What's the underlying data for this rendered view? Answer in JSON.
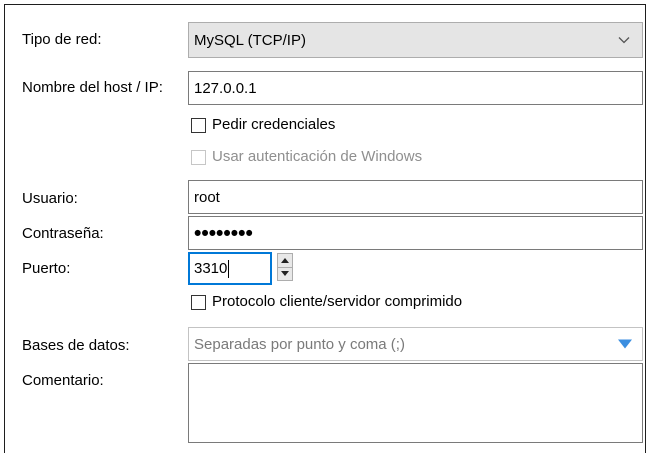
{
  "form": {
    "network_type": {
      "label": "Tipo de red:",
      "value": "MySQL (TCP/IP)"
    },
    "host": {
      "label": "Nombre del host / IP:",
      "value": "127.0.0.1"
    },
    "ask_credentials": {
      "label": "Pedir credenciales",
      "checked": false
    },
    "windows_auth": {
      "label": "Usar autenticación de Windows",
      "checked": false,
      "enabled": false
    },
    "user": {
      "label": "Usuario:",
      "value": "root"
    },
    "password": {
      "label": "Contraseña:",
      "masked_value": "••••••••"
    },
    "port": {
      "label": "Puerto:",
      "value": "3310"
    },
    "compressed": {
      "label": "Protocolo cliente/servidor comprimido",
      "checked": false
    },
    "databases": {
      "label": "Bases de datos:",
      "placeholder": "Separadas por punto y coma (;)"
    },
    "comment": {
      "label": "Comentario:",
      "value": ""
    }
  },
  "icons": {
    "combo_arrow": "chevron-down-icon",
    "databases_arrow": "triangle-down-icon",
    "spin_up": "spin-up-icon",
    "spin_down": "spin-down-icon"
  },
  "colors": {
    "dropdown_arrow": "#3b8ee0",
    "disabled_text": "#8f8f8f",
    "focus_border": "#0078d7"
  }
}
